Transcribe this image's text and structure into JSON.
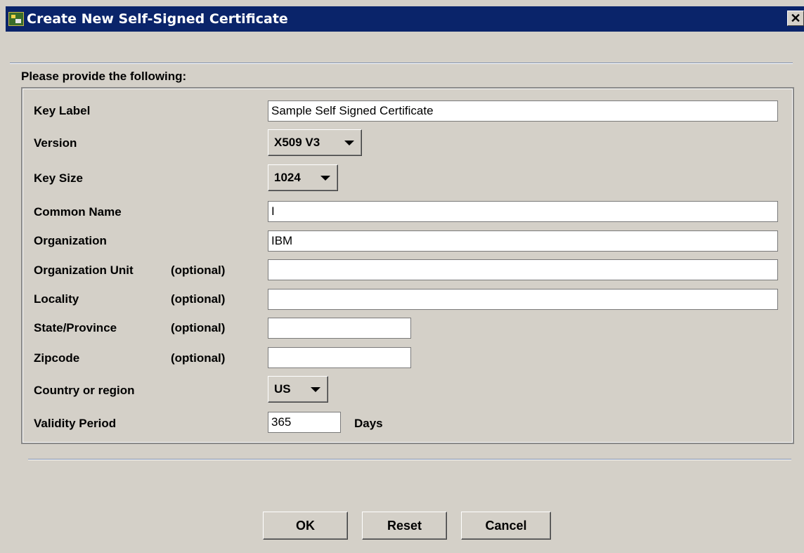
{
  "window": {
    "title": "Create New Self-Signed Certificate",
    "close_glyph": "✕"
  },
  "section_title": "Please provide the following:",
  "fields": {
    "key_label": {
      "label": "Key Label",
      "value": "Sample Self Signed Certificate"
    },
    "version": {
      "label": "Version",
      "value": "X509 V3"
    },
    "key_size": {
      "label": "Key Size",
      "value": "1024"
    },
    "common_name": {
      "label": "Common Name",
      "value": "I"
    },
    "organization": {
      "label": "Organization",
      "value": "IBM"
    },
    "organization_unit": {
      "label": "Organization Unit",
      "optional": "(optional)",
      "value": ""
    },
    "locality": {
      "label": "Locality",
      "optional": "(optional)",
      "value": ""
    },
    "state_province": {
      "label": "State/Province",
      "optional": "(optional)",
      "value": ""
    },
    "zipcode": {
      "label": "Zipcode",
      "optional": "(optional)",
      "value": ""
    },
    "country": {
      "label": "Country or region",
      "value": "US"
    },
    "validity": {
      "label": "Validity Period",
      "value": "365",
      "unit": "Days"
    }
  },
  "buttons": {
    "ok": "OK",
    "reset": "Reset",
    "cancel": "Cancel"
  },
  "colors": {
    "titlebar": "#0a246a",
    "dialog_bg": "#d4d0c8",
    "field_bg": "#ffffff"
  },
  "icons": {
    "app": "certificate-app-icon",
    "close": "close-icon",
    "dropdown": "chevron-down-icon"
  }
}
